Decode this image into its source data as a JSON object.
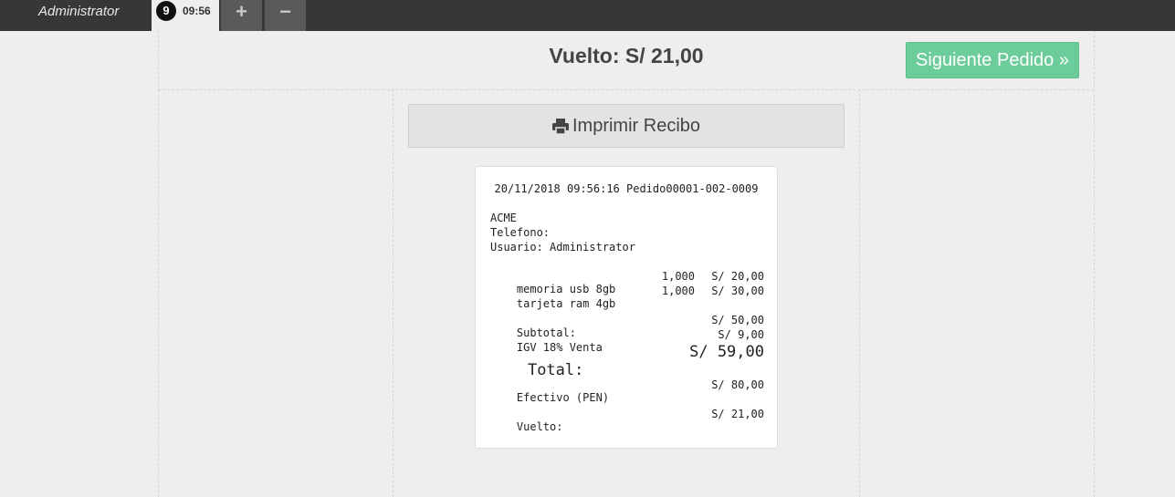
{
  "topbar": {
    "user_name": "Administrator",
    "order_badge": "9",
    "order_time": "09:56",
    "add_tab": "+",
    "remove_tab": "−"
  },
  "header": {
    "change_label": "Vuelto: S/ 21,00",
    "next_button": "Siguiente Pedido »"
  },
  "print_button": "Imprimir Recibo",
  "receipt": {
    "header": "20/11/2018 09:56:16 Pedido00001-002-0009",
    "company": "ACME",
    "phone_label": "Telefono:",
    "user_label": "Usuario: Administrator",
    "items": [
      {
        "name": "memoria usb 8gb",
        "qty": "1,000",
        "price": "S/ 20,00"
      },
      {
        "name": "tarjeta ram 4gb",
        "qty": "1,000",
        "price": "S/ 30,00"
      }
    ],
    "subtotal_label": "Subtotal:",
    "subtotal_value": "S/ 50,00",
    "tax_label": "IGV 18% Venta",
    "tax_value": "S/ 9,00",
    "total_label": "Total:",
    "total_value": "S/ 59,00",
    "cash_label": "Efectivo (PEN)",
    "cash_value": "S/ 80,00",
    "change_label": "Vuelto:",
    "change_value": "S/ 21,00"
  }
}
